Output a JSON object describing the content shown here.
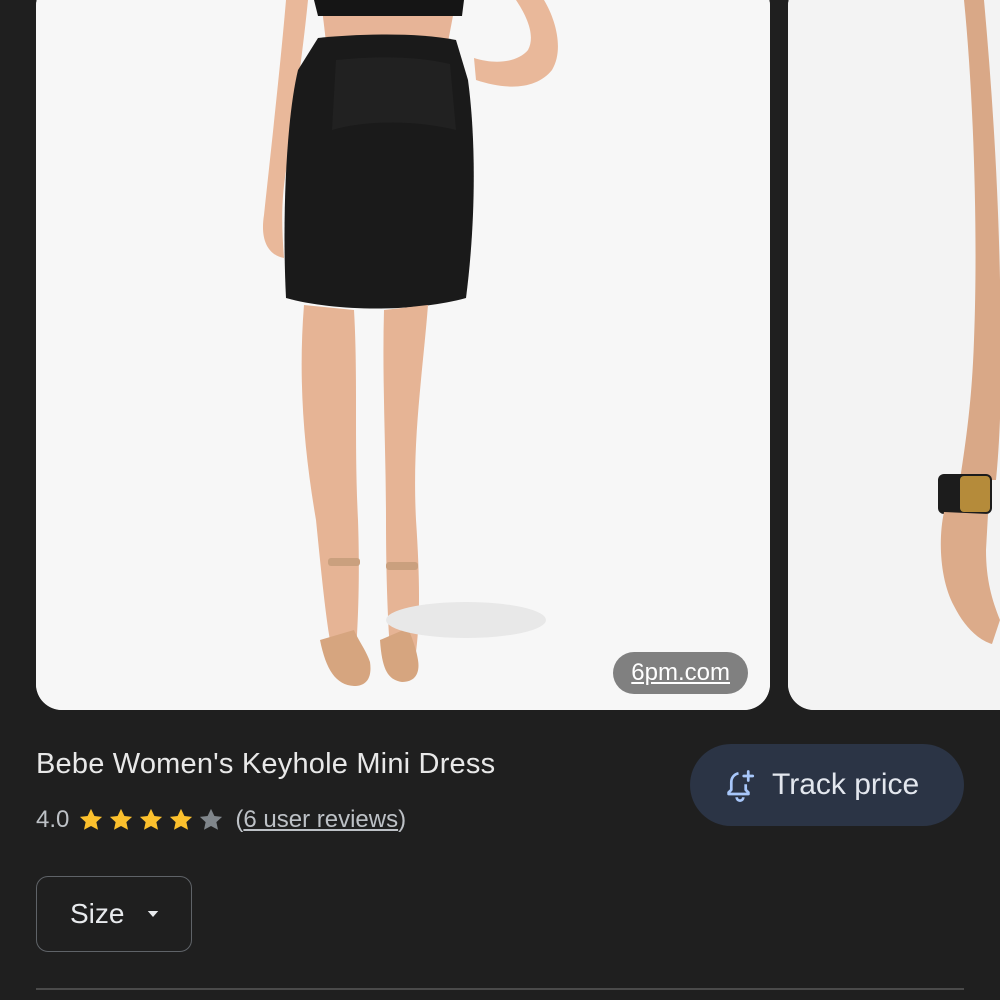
{
  "carousel": {
    "main_image": {
      "alt": "Black leather mini dress with keyhole cutout worn with nude strappy sandals",
      "source_chip": "6pm.com"
    },
    "next_image": {
      "alt": "Partial view of model with gold cuff bracelet"
    }
  },
  "product": {
    "title": "Bebe Women's Keyhole Mini Dress",
    "rating_value": "4.0",
    "rating_stars": 4,
    "rating_max": 5,
    "reviews_open": "(",
    "reviews_label": "6 user reviews",
    "reviews_close": ")"
  },
  "track_price": {
    "label": "Track price",
    "icon": "bell-plus-icon"
  },
  "size_dropdown": {
    "label": "Size",
    "icon": "caret-down-icon"
  },
  "colors": {
    "background": "#1f1f1f",
    "star_filled": "#fbc02d",
    "star_empty": "#80868b",
    "track_button_bg": "#2b3445",
    "track_icon": "#a8c7fa"
  }
}
